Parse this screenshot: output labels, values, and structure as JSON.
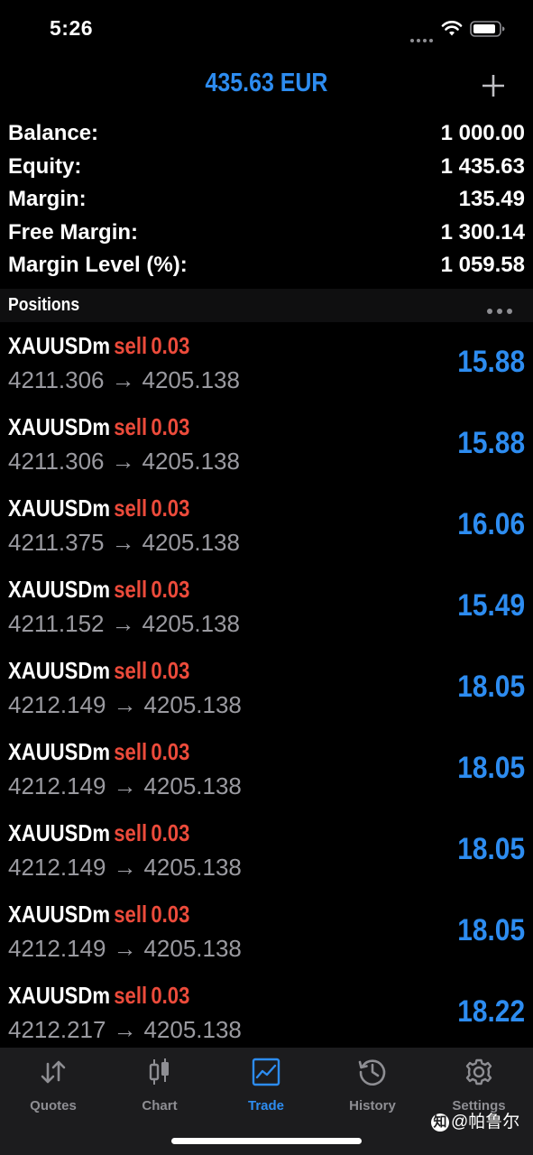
{
  "status_bar": {
    "time": "5:26"
  },
  "header": {
    "title": "435.63 EUR",
    "add_icon": "plus-icon"
  },
  "summary": [
    {
      "label": "Balance:",
      "value": "1 000.00"
    },
    {
      "label": "Equity:",
      "value": "1 435.63"
    },
    {
      "label": "Margin:",
      "value": "135.49"
    },
    {
      "label": "Free Margin:",
      "value": "1 300.14"
    },
    {
      "label": "Margin Level (%):",
      "value": "1 059.58"
    }
  ],
  "positions": {
    "title": "Positions",
    "rows": [
      {
        "symbol": "XAUUSDm",
        "side": "sell",
        "volume": "0.03",
        "open": "4211.306",
        "arrow": "→",
        "current": "4205.138",
        "profit": "15.88"
      },
      {
        "symbol": "XAUUSDm",
        "side": "sell",
        "volume": "0.03",
        "open": "4211.306",
        "arrow": "→",
        "current": "4205.138",
        "profit": "15.88"
      },
      {
        "symbol": "XAUUSDm",
        "side": "sell",
        "volume": "0.03",
        "open": "4211.375",
        "arrow": "→",
        "current": "4205.138",
        "profit": "16.06"
      },
      {
        "symbol": "XAUUSDm",
        "side": "sell",
        "volume": "0.03",
        "open": "4211.152",
        "arrow": "→",
        "current": "4205.138",
        "profit": "15.49"
      },
      {
        "symbol": "XAUUSDm",
        "side": "sell",
        "volume": "0.03",
        "open": "4212.149",
        "arrow": "→",
        "current": "4205.138",
        "profit": "18.05"
      },
      {
        "symbol": "XAUUSDm",
        "side": "sell",
        "volume": "0.03",
        "open": "4212.149",
        "arrow": "→",
        "current": "4205.138",
        "profit": "18.05"
      },
      {
        "symbol": "XAUUSDm",
        "side": "sell",
        "volume": "0.03",
        "open": "4212.149",
        "arrow": "→",
        "current": "4205.138",
        "profit": "18.05"
      },
      {
        "symbol": "XAUUSDm",
        "side": "sell",
        "volume": "0.03",
        "open": "4212.149",
        "arrow": "→",
        "current": "4205.138",
        "profit": "18.05"
      },
      {
        "symbol": "XAUUSDm",
        "side": "sell",
        "volume": "0.03",
        "open": "4212.217",
        "arrow": "→",
        "current": "4205.138",
        "profit": "18.22"
      }
    ]
  },
  "tabs": [
    {
      "label": "Quotes",
      "icon": "quotes-arrows-icon",
      "active": false
    },
    {
      "label": "Chart",
      "icon": "candlestick-chart-icon",
      "active": false
    },
    {
      "label": "Trade",
      "icon": "trade-chart-icon",
      "active": true
    },
    {
      "label": "History",
      "icon": "history-clock-icon",
      "active": false
    },
    {
      "label": "Settings",
      "icon": "gear-icon",
      "active": false
    }
  ],
  "watermark": {
    "text": "@帕鲁尔",
    "logo": "知"
  },
  "colors": {
    "accent_blue": "#2d8cf0",
    "sell_red": "#ec4b3b",
    "price_gray": "#9a9aa0",
    "tab_bar_bg": "#1c1c1e"
  }
}
